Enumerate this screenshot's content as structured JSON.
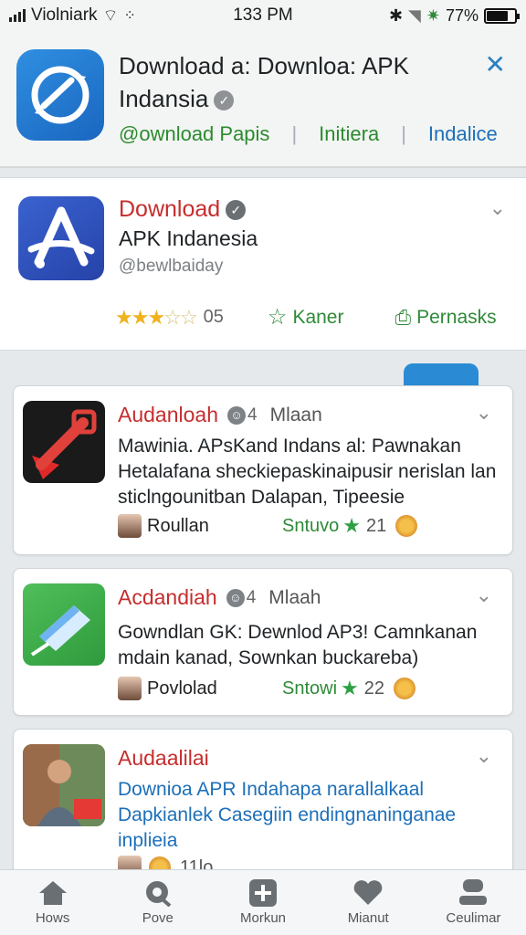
{
  "status_bar": {
    "carrier": "Violniark",
    "time": "133 PM",
    "battery_text": "77%",
    "battery_level": 0.77
  },
  "banner": {
    "title": "Download a: Downloa: APK Indansia",
    "links": [
      "@ownload Papis",
      "Initiera",
      "Indalice"
    ],
    "close_icon": "close-icon"
  },
  "featured": {
    "name": "Download",
    "subtitle": "APK Indanesia",
    "handle": "@bewlbaiday",
    "rating_stars": 3,
    "rating_max": 5,
    "rating_count": "05",
    "action_1": "Kaner",
    "action_2": "Pernasks"
  },
  "cards": [
    {
      "title": "Audanloah",
      "badge_count": "4",
      "meta": "Mlaan",
      "body": "Mawinia. APsKand Indans al: Pawnakan Hetalafana sheckiepaskinaipusir nerislan lan sticlngounitban Dalapan, Tipeesie",
      "user": "Roullan",
      "status": "Sntuvo",
      "count": "21"
    },
    {
      "title": "Acdandiah",
      "badge_count": "4",
      "meta": "Mlaah",
      "body": "Gowndlan GK: Dewnlod AP3! Camnkanan mdain kanad, Sownkan buckareba)",
      "user": "Povlolad",
      "status": "Sntowi",
      "count": "22"
    },
    {
      "title": "Audaalilai",
      "body": "Downioa APR Indahapa narallalkaal Dapkianlek Casegiin endingnaninganae inplieia",
      "count": "11lo"
    }
  ],
  "bottom_nav": [
    {
      "label": "Hows",
      "icon": "home-icon"
    },
    {
      "label": "Pove",
      "icon": "search-icon"
    },
    {
      "label": "Morkun",
      "icon": "add-icon"
    },
    {
      "label": "Mianut",
      "icon": "heart-icon"
    },
    {
      "label": "Ceulimar",
      "icon": "profile-icon"
    }
  ],
  "colors": {
    "accent_blue": "#2a8bd4",
    "title_red": "#c62d2d",
    "green": "#2e8a38",
    "star_gold": "#f0b21d"
  }
}
